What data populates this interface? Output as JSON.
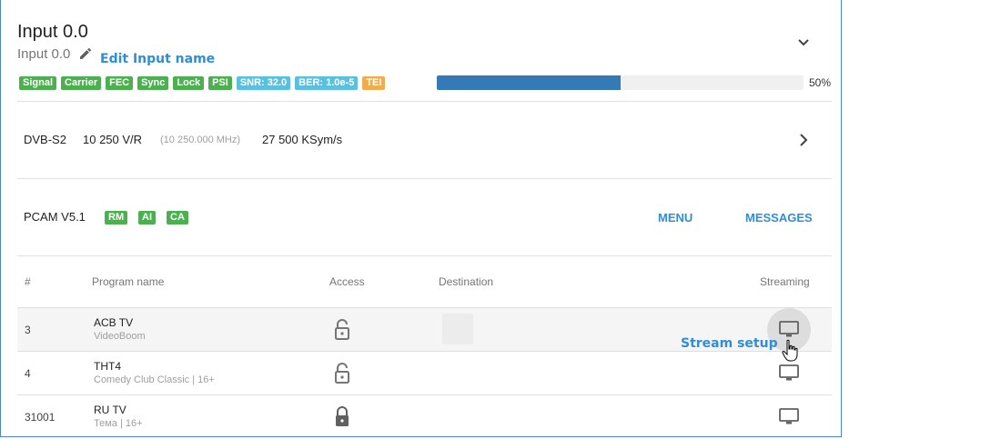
{
  "header": {
    "title": "Input 0.0",
    "subtitle": "Input 0.0",
    "edit_hint": "Edit Input name",
    "badges": [
      {
        "label": "Signal",
        "color": "#4caf50"
      },
      {
        "label": "Carrier",
        "color": "#4caf50"
      },
      {
        "label": "FEC",
        "color": "#4caf50"
      },
      {
        "label": "Sync",
        "color": "#4caf50"
      },
      {
        "label": "Lock",
        "color": "#4caf50"
      },
      {
        "label": "PSI",
        "color": "#4caf50"
      },
      {
        "label": "SNR: 32.0",
        "color": "#5bc0de"
      },
      {
        "label": "BER: 1.0e-5",
        "color": "#5bc0de"
      },
      {
        "label": "TEI",
        "color": "#f0ad4e"
      }
    ],
    "progress_percent": 50,
    "progress_label": "50%"
  },
  "tuning": {
    "standard": "DVB-S2",
    "frequency": "10 250 V/R",
    "frequency_detail": "(10 250.000 MHz)",
    "symbol_rate": "27 500 KSym/s"
  },
  "cam": {
    "name": "PCAM V5.1",
    "badges": [
      "RM",
      "AI",
      "CA"
    ],
    "menu_label": "MENU",
    "messages_label": "MESSAGES"
  },
  "table": {
    "headers": {
      "num": "#",
      "program": "Program name",
      "access": "Access",
      "destination": "Destination",
      "streaming": "Streaming"
    },
    "rows": [
      {
        "num": "3",
        "name": "ACB TV",
        "provider": "VideoBoom",
        "access": "unlocked",
        "highlighted": true
      },
      {
        "num": "4",
        "name": "THT4",
        "provider": "Comedy Club Classic | 16+",
        "access": "unlocked",
        "highlighted": false
      },
      {
        "num": "31001",
        "name": "RU TV",
        "provider": "Тема | 16+",
        "access": "locked",
        "highlighted": false
      }
    ],
    "stream_setup_hint": "Stream setup"
  },
  "colors": {
    "accent": "#2f8ed6",
    "progress": "#337ab7",
    "badge_green": "#4caf50",
    "badge_cyan": "#5bc0de",
    "badge_orange": "#f0ad4e"
  }
}
